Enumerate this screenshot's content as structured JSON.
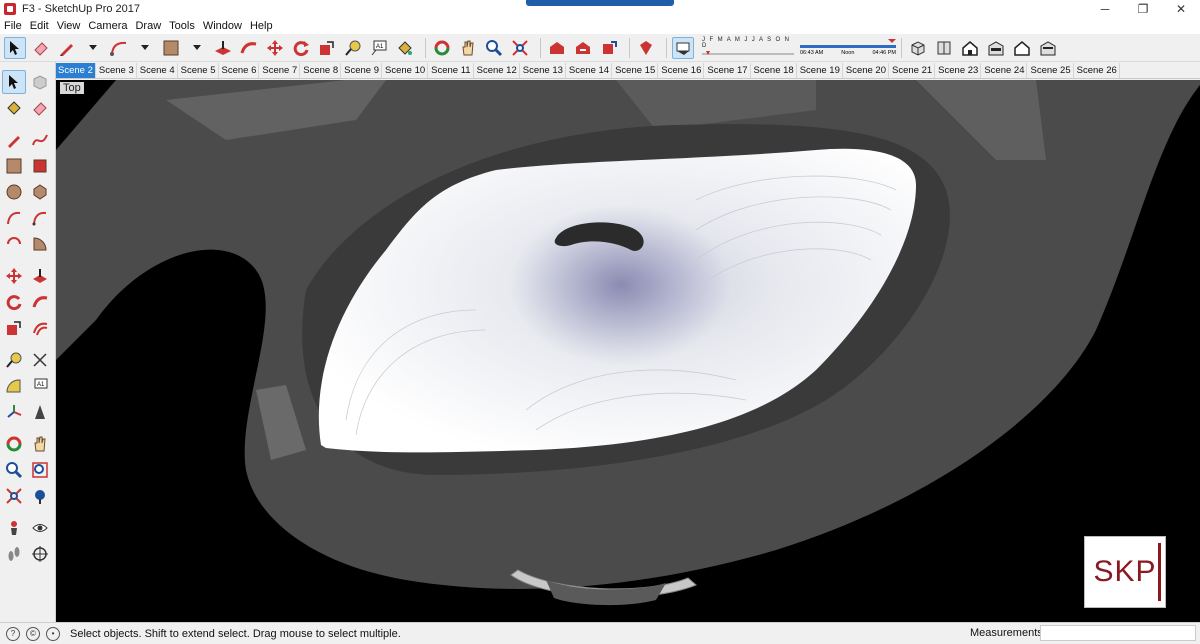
{
  "window": {
    "title": "F3 - SketchUp Pro 2017",
    "controls": {
      "minimize": "─",
      "maximize": "❐",
      "close": "✕"
    }
  },
  "menu": [
    "File",
    "Edit",
    "View",
    "Camera",
    "Draw",
    "Tools",
    "Window",
    "Help"
  ],
  "toolbar": {
    "shadow_months": "J F M A M J J A S O N D",
    "time_start": "06:43 AM",
    "time_noon": "Noon",
    "time_end": "04:46 PM"
  },
  "scenes": {
    "active": "Scene 2",
    "tabs": [
      "Scene 2",
      "Scene 3",
      "Scene 4",
      "Scene 5",
      "Scene 6",
      "Scene 7",
      "Scene 8",
      "Scene 9",
      "Scene 10",
      "Scene 11",
      "Scene 12",
      "Scene 13",
      "Scene 14",
      "Scene 15",
      "Scene 16",
      "Scene 17",
      "Scene 18",
      "Scene 19",
      "Scene 20",
      "Scene 21",
      "Scene 23",
      "Scene 24",
      "Scene 25",
      "Scene 26"
    ]
  },
  "viewport": {
    "view_label": "Top",
    "logo_text": "SKP"
  },
  "status": {
    "message": "Select objects. Shift to extend select. Drag mouse to select multiple.",
    "measurements_label": "Measurements",
    "measurements_value": ""
  },
  "colors": {
    "accent": "#2b7fd3",
    "viewport_bg": "#000000",
    "model_gray": "#4a4a4a",
    "logo_red": "#8a1a22"
  }
}
